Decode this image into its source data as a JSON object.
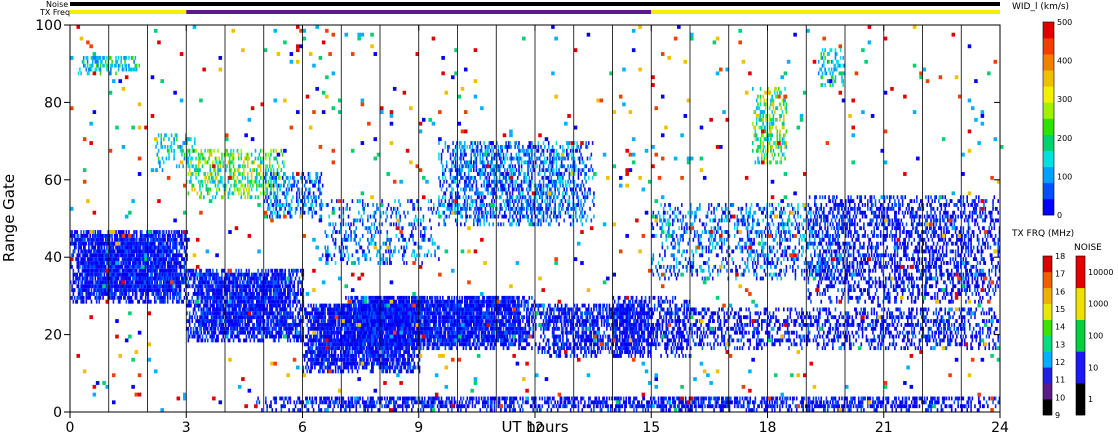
{
  "chart_data": {
    "type": "heatmap",
    "title": "",
    "xlabel": "UT hours",
    "ylabel": "Range Gate",
    "x_ticks": [
      "0",
      "3",
      "6",
      "9",
      "12",
      "15",
      "18",
      "21",
      "24"
    ],
    "y_ticks": [
      "0",
      "20",
      "40",
      "60",
      "80",
      "100"
    ],
    "xlim": [
      0,
      24
    ],
    "ylim": [
      0,
      100
    ],
    "grid": "vertical lines every hour",
    "top_bars": {
      "noise_label": "Noise",
      "txfreq_label": "TX Freq",
      "noise_color": "#000000",
      "txfreq_segments": [
        {
          "start": 0,
          "end": 3,
          "color": "#f0f000"
        },
        {
          "start": 3,
          "end": 15,
          "color": "#5a1a8a"
        },
        {
          "start": 15,
          "end": 24,
          "color": "#f0f000"
        }
      ]
    },
    "colorbar_width": {
      "title": "WID_l (km/s)",
      "ticks": [
        "0",
        "100",
        "200",
        "300",
        "400",
        "500"
      ],
      "range": [
        0,
        500
      ],
      "colors": [
        "#0000ff",
        "#0050ff",
        "#00a0ff",
        "#00e0e0",
        "#00d070",
        "#30e000",
        "#a0f000",
        "#f0f000",
        "#f0c000",
        "#f08000",
        "#f04000",
        "#e00000"
      ]
    },
    "colorbar_txfreq": {
      "title": "TX FRQ (MHz)",
      "ticks": [
        "9",
        "10",
        "11",
        "12",
        "13",
        "14",
        "15",
        "16",
        "17",
        "18"
      ],
      "colors": [
        "#000000",
        "#5a1a8a",
        "#2020e0",
        "#00b0ff",
        "#00e080",
        "#40e000",
        "#e8e800",
        "#f0b000",
        "#f06000",
        "#e00000"
      ]
    },
    "colorbar_noise": {
      "title": "NOISE",
      "ticks": [
        "1",
        "10",
        "100",
        "1000",
        "10000"
      ],
      "colors": [
        "#000000",
        "#1a1af0",
        "#00d040",
        "#f0e000",
        "#e00000"
      ]
    },
    "echo_regions": [
      {
        "x0": 0,
        "x1": 3,
        "y0": 28,
        "y1": 47,
        "density": 0.92,
        "mix": "blue"
      },
      {
        "x0": 3,
        "x1": 6,
        "y0": 18,
        "y1": 37,
        "density": 0.85,
        "mix": "blue"
      },
      {
        "x0": 6,
        "x1": 9,
        "y0": 10,
        "y1": 28,
        "density": 0.85,
        "mix": "blue"
      },
      {
        "x0": 7,
        "x1": 12,
        "y0": 16,
        "y1": 30,
        "density": 0.9,
        "mix": "blue"
      },
      {
        "x0": 12,
        "x1": 15,
        "y0": 14,
        "y1": 28,
        "density": 0.65,
        "mix": "blue"
      },
      {
        "x0": 9.5,
        "x1": 13.5,
        "y0": 48,
        "y1": 70,
        "density": 0.5,
        "mix": "bluecyan"
      },
      {
        "x0": 6.5,
        "x1": 9.5,
        "y0": 38,
        "y1": 55,
        "density": 0.25,
        "mix": "bluecyan"
      },
      {
        "x0": 3,
        "x1": 5.5,
        "y0": 55,
        "y1": 68,
        "density": 0.4,
        "mix": "green"
      },
      {
        "x0": 5,
        "x1": 6.5,
        "y0": 50,
        "y1": 62,
        "density": 0.45,
        "mix": "bluecyan"
      },
      {
        "x0": 2.2,
        "x1": 3.2,
        "y0": 62,
        "y1": 72,
        "density": 0.3,
        "mix": "cyan"
      },
      {
        "x0": 0.2,
        "x1": 1.8,
        "y0": 87,
        "y1": 92,
        "density": 0.55,
        "mix": "cyan"
      },
      {
        "x0": 17.6,
        "x1": 18.5,
        "y0": 64,
        "y1": 84,
        "density": 0.45,
        "mix": "green"
      },
      {
        "x0": 19.3,
        "x1": 20.0,
        "y0": 84,
        "y1": 94,
        "density": 0.35,
        "mix": "cyan"
      },
      {
        "x0": 15,
        "x1": 20,
        "y0": 34,
        "y1": 54,
        "density": 0.3,
        "mix": "bluecyan"
      },
      {
        "x0": 19,
        "x1": 24,
        "y0": 28,
        "y1": 56,
        "density": 0.45,
        "mix": "blue"
      },
      {
        "x0": 15,
        "x1": 24,
        "y0": 16,
        "y1": 27,
        "density": 0.4,
        "mix": "blue"
      },
      {
        "x0": 14,
        "x1": 16,
        "y0": 14,
        "y1": 30,
        "density": 0.45,
        "mix": "blue"
      },
      {
        "x0": 4.8,
        "x1": 24,
        "y0": 0,
        "y1": 4,
        "density": 0.6,
        "mix": "blue"
      },
      {
        "x0": 0,
        "x1": 24,
        "y0": 0,
        "y1": 100,
        "density": 0.025,
        "mix": "scatter"
      }
    ]
  }
}
